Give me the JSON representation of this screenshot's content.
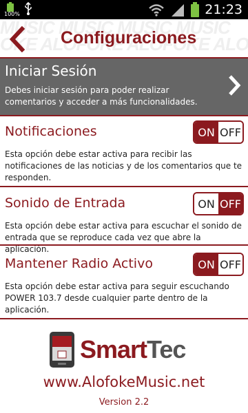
{
  "status_bar": {
    "battery_small_label": "100%",
    "time": "21:23",
    "icons": [
      "battery-charging-icon",
      "usb-icon",
      "wifi-icon",
      "signal-icon",
      "battery-icon"
    ]
  },
  "header": {
    "title": "Configuraciones",
    "back_icon": "chevron-left-icon",
    "watermark_lines": [
      "MUSIC  MUSIC  MUSIC  MUSIC",
      "OKE  ALOFOKE  ALOFOKE  ALOFO"
    ]
  },
  "login": {
    "title": "Iniciar Sesión",
    "description": "Debes iniciar sesión para poder realizar comentarios y acceder a más funcionalidades.",
    "icon": "chevron-right-icon"
  },
  "settings": [
    {
      "title": "Notificaciones",
      "description": "Esta opción debe estar activa para recibir las notificaciones de las noticias y de los comentarios que te responden.",
      "on_label": "ON",
      "off_label": "OFF",
      "state": "on"
    },
    {
      "title": "Sonido de Entrada",
      "description": "Esta opción debe estar activa para escuchar el sonido de entrada que se reproduce cada vez que abre la aplicación.",
      "on_label": "ON",
      "off_label": "OFF",
      "state": "off"
    },
    {
      "title": "Mantener Radio Activo",
      "description": "Esta opción debe estar activa para seguir escuchando POWER 103.7 desde cualquier parte dentro de la aplicación.",
      "on_label": "ON",
      "off_label": "OFF",
      "state": "on"
    }
  ],
  "footer": {
    "logo_part1": "Smart",
    "logo_part2": "Tec",
    "logo_icon": "smarttec-phone-logo",
    "website": "www.AlofokeMusic.net",
    "version": "Version 2.2"
  },
  "colors": {
    "accent": "#8b1a1f",
    "login_bg": "#666666",
    "battery": "#7ec242"
  }
}
